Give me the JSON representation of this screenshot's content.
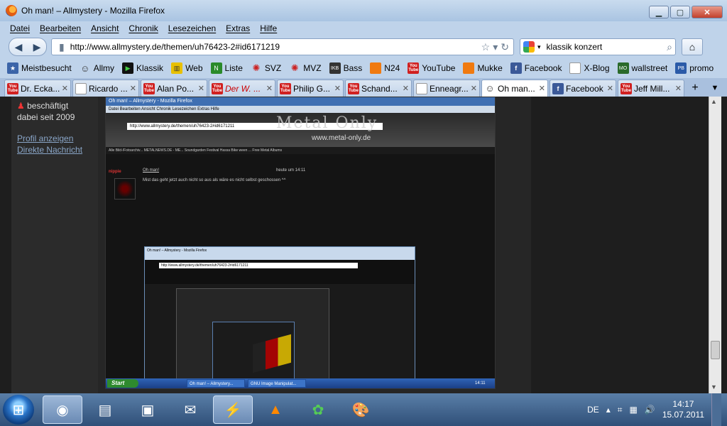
{
  "window": {
    "title": "Oh man! – Allmystery - Mozilla Firefox"
  },
  "menu": [
    "Datei",
    "Bearbeiten",
    "Ansicht",
    "Chronik",
    "Lesezeichen",
    "Extras",
    "Hilfe"
  ],
  "nav": {
    "url": "http://www.allmystery.de/themen/uh76423-2#id6171219",
    "search_value": "klassik konzert"
  },
  "bookmarks": [
    {
      "label": "Meistbesucht",
      "icon": "bookmark-icon"
    },
    {
      "label": "Allmy",
      "icon": "allmy-icon"
    },
    {
      "label": "Klassik",
      "icon": "klassik-icon"
    },
    {
      "label": "Web",
      "icon": "web-icon"
    },
    {
      "label": "Liste",
      "icon": "liste-icon"
    },
    {
      "label": "SVZ",
      "icon": "svz-icon"
    },
    {
      "label": "MVZ",
      "icon": "mvz-icon"
    },
    {
      "label": "Bass",
      "icon": "bass-icon"
    },
    {
      "label": "N24",
      "icon": "n24-icon"
    },
    {
      "label": "YouTube",
      "icon": "youtube-icon"
    },
    {
      "label": "Mukke",
      "icon": "mukke-icon"
    },
    {
      "label": "Facebook",
      "icon": "facebook-icon"
    },
    {
      "label": "X-Blog",
      "icon": "page-icon"
    },
    {
      "label": "wallstreet",
      "icon": "wallstreet-icon"
    },
    {
      "label": "promo",
      "icon": "promo-icon"
    }
  ],
  "tabs": [
    {
      "label": "Dr. Ecka...",
      "icon": "youtube"
    },
    {
      "label": "Ricardo ...",
      "icon": "page"
    },
    {
      "label": "Alan Po...",
      "icon": "youtube"
    },
    {
      "label": "Der W. ...",
      "icon": "youtube",
      "style": "red"
    },
    {
      "label": "Philip G...",
      "icon": "youtube"
    },
    {
      "label": "Schand...",
      "icon": "youtube"
    },
    {
      "label": "Enneagr...",
      "icon": "page"
    },
    {
      "label": "Oh man...",
      "icon": "allmy",
      "active": true
    },
    {
      "label": "Facebook",
      "icon": "facebook"
    },
    {
      "label": "Jeff Mill...",
      "icon": "youtube"
    }
  ],
  "sidebar": {
    "status_busy": "beschäftigt",
    "member_since": "dabei seit 2009",
    "profile_link": "Profil anzeigen",
    "message_link": "Direkte Nachricht"
  },
  "embedded": {
    "title": "Oh man! – Allmystery - Mozilla Firefox",
    "menu": "Datei  Bearbeiten  Ansicht  Chronik  Lesezeichen  Extras  Hilfe",
    "url": "http://www.allmystery.de/themen/uh76423-2#id6171211",
    "logo": "Metal Only",
    "logo_url": "www.metal-only.de",
    "bookmarks": "Alle Bild-/Fotoarchiv...  METALNEWS.DE - ME...  Soundgarden Festival  Hassa Bike ween  ... Free Metal Albums",
    "nick": "nippie",
    "post_link": "Oh man!",
    "post_time": "heute um 14:11",
    "post_text": "Mist das geht jetzt auch nicht so aus als wäre es nicht selbst geschossen ^^",
    "task_start": "Start",
    "task1": "Oh man! – Allmystery...",
    "task2": "GNU Image Manipulat...",
    "clock": "14:11"
  },
  "taskbar": {
    "language": "DE",
    "time": "14:17",
    "date": "15.07.2011"
  }
}
